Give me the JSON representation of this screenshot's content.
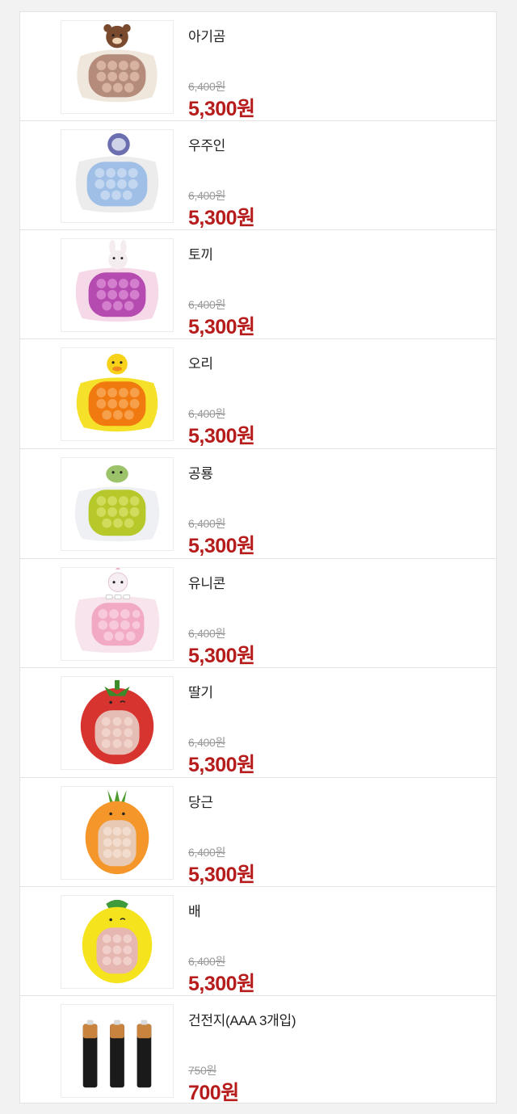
{
  "products": [
    {
      "name": "아기곰",
      "original_price": "6,400원",
      "sale_price": "5,300원",
      "icon": "bear-popit-toy-icon",
      "body_color": "#efe6dc",
      "bubble_color": "#b58c7b",
      "topper_color": "#7a4a2e"
    },
    {
      "name": "우주인",
      "original_price": "6,400원",
      "sale_price": "5,300원",
      "icon": "astronaut-popit-toy-icon",
      "body_color": "#ececec",
      "bubble_color": "#9fbfe6",
      "topper_color": "#6b6fb0"
    },
    {
      "name": "토끼",
      "original_price": "6,400원",
      "sale_price": "5,300원",
      "icon": "rabbit-popit-toy-icon",
      "body_color": "#f6d9e8",
      "bubble_color": "#b54ab0",
      "topper_color": "#f4ecee"
    },
    {
      "name": "오리",
      "original_price": "6,400원",
      "sale_price": "5,300원",
      "icon": "duck-popit-toy-icon",
      "body_color": "#f6e12a",
      "bubble_color": "#f07a10",
      "topper_color": "#f7d21a"
    },
    {
      "name": "공룡",
      "original_price": "6,400원",
      "sale_price": "5,300원",
      "icon": "dinosaur-popit-toy-icon",
      "body_color": "#eef0f4",
      "bubble_color": "#b6c82a",
      "topper_color": "#9cc36a"
    },
    {
      "name": "유니콘",
      "original_price": "6,400원",
      "sale_price": "5,300원",
      "icon": "unicorn-popit-toy-icon",
      "body_color": "#f7e4ec",
      "bubble_color": "#f1a9c4",
      "topper_color": "#f6eef3"
    },
    {
      "name": "딸기",
      "original_price": "6,400원",
      "sale_price": "5,300원",
      "icon": "strawberry-popit-toy-icon",
      "body_color": "#d8342f",
      "bubble_color": "#e6bdb4",
      "topper_color": "#3d8a2a"
    },
    {
      "name": "당근",
      "original_price": "6,400원",
      "sale_price": "5,300원",
      "icon": "carrot-popit-toy-icon",
      "body_color": "#f4962a",
      "bubble_color": "#e8c9b4",
      "topper_color": "#4e9a2e"
    },
    {
      "name": "배",
      "original_price": "6,400원",
      "sale_price": "5,300원",
      "icon": "pear-popit-toy-icon",
      "body_color": "#f4e31d",
      "bubble_color": "#e6b7b0",
      "topper_color": "#3f9a3a"
    },
    {
      "name": "건전지(AAA 3개입)",
      "original_price": "750원",
      "sale_price": "700원",
      "icon": "aaa-battery-icon",
      "body_color": "#1a1a1a",
      "bubble_color": "#c8843f",
      "topper_color": "#d9d9d9"
    }
  ],
  "colors": {
    "sale_price": "#b71c1c",
    "original_price": "#9a9a9a",
    "divider": "#e3e3e3"
  }
}
